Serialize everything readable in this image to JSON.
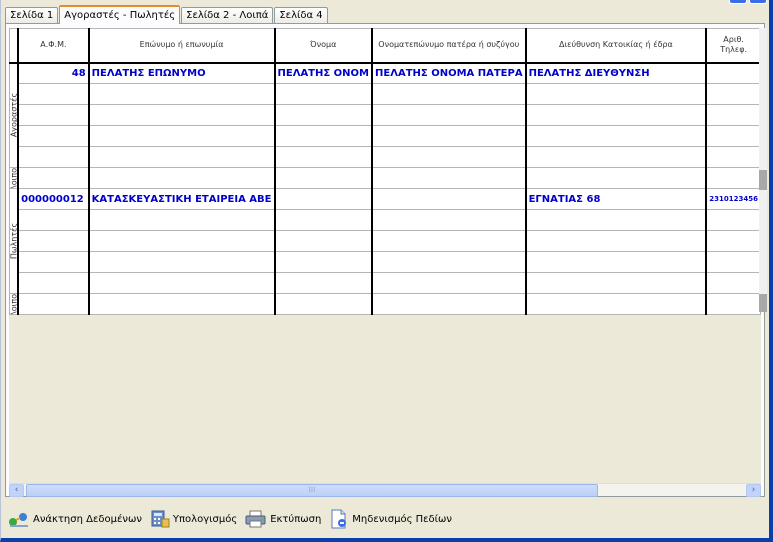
{
  "tabs": [
    {
      "label": "Σελίδα 1",
      "active": false
    },
    {
      "label": "Αγοραστές - Πωλητές",
      "active": true
    },
    {
      "label": "Σελίδα 2 - Λοιπά",
      "active": false
    },
    {
      "label": "Σελίδα 4",
      "active": false
    }
  ],
  "grid": {
    "columns": [
      "Α.Φ.Μ.",
      "Επώνυμο ή επωνυμία",
      "Όνομα",
      "Ονοματεπώνυμο πατέρα ή συζύγου",
      "Διεύθυνση Κατοικίας ή έδρα",
      "Αριθ. Τηλεφ."
    ],
    "sections": {
      "buyers_label": "Αγοραστές",
      "buyers_extra_label": "Λοιποί",
      "sellers_label": "Πωλητές",
      "sellers_extra_label": "Λοιποί"
    },
    "buyer_row": {
      "afm": "48",
      "surname": "ΠΕΛΑΤΗΣ ΕΠΩΝΥΜΟ",
      "name": "ΠΕΛΑΤΗΣ ΟΝΟΜ",
      "father": "ΠΕΛΑΤΗΣ ΟΝΟΜΑ ΠΑΤΕΡΑ",
      "address": "ΠΕΛΑΤΗΣ ΔΙΕΥΘΥΝΣΗ",
      "phone": ""
    },
    "seller_row": {
      "afm": "000000012",
      "surname": "ΚΑΤΑΣΚΕΥΑΣΤΙΚΗ ΕΤΑΙΡΕΙΑ ΑΒΕ",
      "name": "",
      "father": "",
      "address": "ΕΓΝΑΤΙΑΣ 68",
      "phone": "2310123456"
    }
  },
  "toolbar": {
    "load_label": "Ανάκτηση Δεδομένων",
    "calc_label": "Υπολογισμός",
    "print_label": "Εκτύπωση",
    "clear_label": "Μηδενισμός Πεδίων"
  },
  "colors": {
    "data_text": "#0000cc",
    "active_tab_accent": "#e68b2c",
    "window_frame": "#0b3fa8"
  },
  "icons": {
    "load": "data-transfer-icon",
    "calc": "calculator-icon",
    "print": "printer-icon",
    "clear": "clear-document-icon"
  }
}
